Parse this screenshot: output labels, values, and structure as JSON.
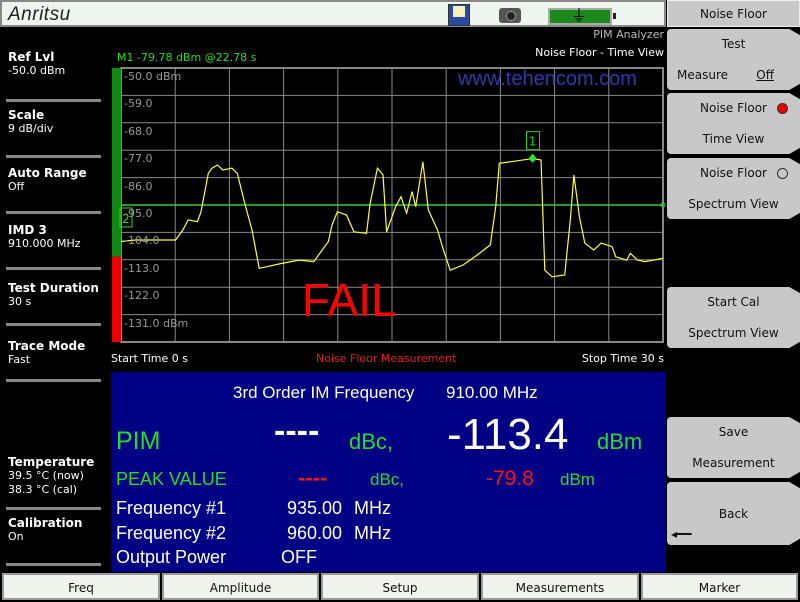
{
  "topbar": {
    "logo": "Anritsu",
    "icons": [
      "save-icon",
      "camera-icon",
      "battery-icon"
    ]
  },
  "header": {
    "mode": "PIM Analyzer",
    "view": "Noise Floor - Time View",
    "marker_readout": "M1 -79.78 dBm @22.78 s",
    "watermark": "www.tehencom.com"
  },
  "left_panel": [
    {
      "label": "Ref Lvl",
      "value": "-50.0 dBm"
    },
    {
      "label": "Scale",
      "value": "9 dB/div"
    },
    {
      "label": "Auto Range",
      "value": "Off"
    },
    {
      "label": "IMD 3",
      "value": "910.000 MHz"
    },
    {
      "label": "Test Duration",
      "value": "30 s"
    },
    {
      "label": "Trace Mode",
      "value": "Fast"
    },
    {
      "label": "Temperature",
      "value": "39.5 °C  (now)",
      "value2": "38.3 °C  (cal)"
    },
    {
      "label": "Calibration",
      "value": "On"
    }
  ],
  "softkeys": {
    "title": "Noise Floor",
    "items": [
      {
        "line1": "Test",
        "line2": "Measure",
        "state": "Off"
      },
      {
        "line1": "Noise Floor",
        "line2": "Time View",
        "selected": true
      },
      {
        "line1": "Noise Floor",
        "line2": "Spectrum View",
        "selected": false
      },
      {
        "line1": "Start Cal",
        "line2": "Spectrum View"
      },
      {
        "line1": "Save",
        "line2": "Measurement"
      },
      {
        "line1": "Back"
      }
    ]
  },
  "chart_footer": {
    "start": "Start Time 0 s",
    "center": "Noise Floor Measurement",
    "stop": "Stop Time  30 s"
  },
  "verdict": "FAIL",
  "chart_data": {
    "type": "line",
    "xlim": [
      0,
      30
    ],
    "ylim": [
      -131,
      -50
    ],
    "y_ticks": [
      "-50.0 dBm",
      "-59.0",
      "-68.0",
      "-77.0",
      "-86.0",
      "-95.0",
      "-104.0",
      "-113.0",
      "-122.0",
      "-131.0 dBm"
    ],
    "x_divisions": 10,
    "grid": true,
    "limit_line": -95,
    "colors": {
      "trace": "#ffff33",
      "limit": "#33cc33",
      "grid": "#888888",
      "pass_bar": "#118811",
      "fail_bar": "#ee0000"
    },
    "markers": [
      {
        "id": "1",
        "x": 22.78,
        "y": -79.78
      },
      {
        "id": "2",
        "y": -95
      }
    ],
    "x": [
      0,
      0.81,
      1.81,
      3.02,
      3.42,
      3.72,
      4.23,
      4.43,
      4.83,
      5.03,
      5.34,
      5.64,
      6.14,
      6.44,
      6.85,
      7.25,
      7.65,
      8.05,
      8.86,
      9.87,
      10.67,
      11.48,
      11.68,
      11.98,
      12.48,
      12.89,
      13.59,
      13.79,
      14.19,
      14.5,
      14.7,
      15.2,
      15.5,
      15.81,
      16.11,
      16.31,
      16.71,
      17.01,
      17.52,
      17.82,
      18.22,
      18.93,
      19.73,
      20.44,
      20.74,
      20.94,
      21.54,
      22.75,
      23.25,
      23.46,
      23.86,
      24.56,
      24.87,
      25.07,
      25.37,
      25.67,
      26.17,
      26.58,
      27.18,
      27.38,
      27.99,
      28.19,
      28.59,
      28.99,
      30
    ],
    "y": [
      -107,
      -106.5,
      -106.5,
      -106.5,
      -103.2,
      -99.9,
      -100.5,
      -97.2,
      -84.6,
      -82.9,
      -81.9,
      -83.5,
      -82.9,
      -84.6,
      -94.5,
      -103.2,
      -115.8,
      -115.3,
      -114.2,
      -113.1,
      -113.6,
      -107,
      -101.6,
      -97.2,
      -98.3,
      -103.8,
      -104.3,
      -94.5,
      -82.9,
      -85.1,
      -103.8,
      -95.6,
      -92.3,
      -97.7,
      -90.6,
      -95.6,
      -80.8,
      -96.6,
      -103.2,
      -109.2,
      -116.4,
      -114.7,
      -111.4,
      -108.1,
      -95.6,
      -81.3,
      -80.8,
      -79.78,
      -80.2,
      -116.4,
      -118.6,
      -118,
      -99.9,
      -85.1,
      -98.8,
      -107.5,
      -109.8,
      -107.5,
      -108.7,
      -112,
      -113.1,
      -110.9,
      -113.1,
      -113.6,
      -112.5
    ]
  },
  "results": {
    "im_label": "3rd Order IM Frequency",
    "im_value": "910.00 MHz",
    "pim_label": "PIM",
    "pim_dbc": "----",
    "dbc_unit": "dBc,",
    "pim_dbm": "-113.4",
    "dbm_unit": "dBm",
    "peak_label": "PEAK VALUE",
    "peak_dbc": "----",
    "peak_dbm": "-79.8",
    "f1_label": "Frequency #1",
    "f1_value": "935.00",
    "f2_label": "Frequency #2",
    "f2_value": "960.00",
    "mhz": "MHz",
    "power_label": "Output Power",
    "power_value": "OFF"
  },
  "tabs": [
    "Freq",
    "Amplitude",
    "Setup",
    "Measurements",
    "Marker"
  ]
}
